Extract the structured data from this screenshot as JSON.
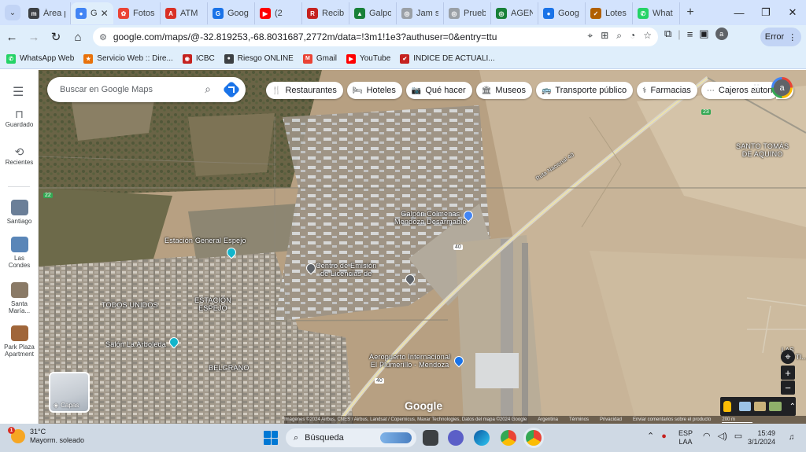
{
  "browser": {
    "tabs": [
      {
        "title": "Área p",
        "color": "#3c4043",
        "glyph": "m"
      },
      {
        "title": "G",
        "color": "#4285f4",
        "glyph": "●",
        "active": true
      },
      {
        "title": "Fotos",
        "color": "#ea4335",
        "glyph": "✿"
      },
      {
        "title": "ATM",
        "color": "#d93025",
        "glyph": "A"
      },
      {
        "title": "Goog",
        "color": "#1a73e8",
        "glyph": "G"
      },
      {
        "title": "(2",
        "color": "#ff0000",
        "glyph": "▶"
      },
      {
        "title": "Recib",
        "color": "#c5221f",
        "glyph": "R"
      },
      {
        "title": "Galpo",
        "color": "#188038",
        "glyph": "▲"
      },
      {
        "title": "Jam s",
        "color": "#9aa0a6",
        "glyph": "◎"
      },
      {
        "title": "Prueb",
        "color": "#9aa0a6",
        "glyph": "◎"
      },
      {
        "title": "AGEN",
        "color": "#188038",
        "glyph": "◎"
      },
      {
        "title": "Goog",
        "color": "#1a73e8",
        "glyph": "●"
      },
      {
        "title": "Lotes",
        "color": "#b06000",
        "glyph": "✓"
      },
      {
        "title": "What",
        "color": "#25d366",
        "glyph": "✆"
      }
    ],
    "url": "google.com/maps/@-32.819253,-68.8031687,2772m/data=!3m1!1e3?authuser=0&entry=ttu",
    "profile_initial": "a",
    "error_label": "Error"
  },
  "bookmarks": [
    {
      "label": "WhatsApp Web",
      "color": "#25d366",
      "glyph": "✆"
    },
    {
      "label": "Servicio Web :: Dire...",
      "color": "#e8710a",
      "glyph": "★"
    },
    {
      "label": "ICBC",
      "color": "#c5221f",
      "glyph": "◉"
    },
    {
      "label": "Riesgo ONLINE",
      "color": "#3c4043",
      "glyph": "●"
    },
    {
      "label": "Gmail",
      "color": "#ea4335",
      "glyph": "M"
    },
    {
      "label": "YouTube",
      "color": "#ff0000",
      "glyph": "▶"
    },
    {
      "label": "INDICE DE ACTUALI...",
      "color": "#c5221f",
      "glyph": "✔"
    }
  ],
  "rail": {
    "saved": "Guardado",
    "recents": "Recientes",
    "places": [
      {
        "label": "Santiago",
        "color": "#6b7f98"
      },
      {
        "label": "Las\nCondes",
        "color": "#5a86b8"
      },
      {
        "label": "Santa\nMaría...",
        "color": "#8a7a66"
      },
      {
        "label": "Park Plaza\nApartment",
        "color": "#a0663a"
      }
    ]
  },
  "maps": {
    "search_placeholder": "Buscar en Google Maps",
    "chips": [
      {
        "label": "Restaurantes",
        "icon": "🍴"
      },
      {
        "label": "Hoteles",
        "icon": "🛏"
      },
      {
        "label": "Qué hacer",
        "icon": "📷"
      },
      {
        "label": "Museos",
        "icon": "🏛"
      },
      {
        "label": "Transporte público",
        "icon": "🚌"
      },
      {
        "label": "Farmacias",
        "icon": "⚕"
      },
      {
        "label": "Cajeros auton",
        "icon": "⋯"
      }
    ],
    "account_initial": "a",
    "labels": {
      "santo_tomas": "SANTO TOMÁS\nDE AQUINO",
      "estacion_espejo": "Estación General Espejo",
      "todos_unidos": "TODOS UNIDOS",
      "estacion_espejo_area": "ESTACIÓN\nESPEJO",
      "salon": "Salón La Arboleda",
      "belgrano": "BELGRANO",
      "gasoline": "Galpón Colmenas\nMendoza Desarmable",
      "centro": "Centro de Emisión\nde Licencias de",
      "aeropuerto": "Aeropuerto Internacional\nEl Plumerillo - Mendoza",
      "ruta": "Ruta Nacional 40",
      "las_tiscas": "LAS\nLAS TI..."
    },
    "roads": {
      "r40a": "40",
      "r40b": "40",
      "r23": "23",
      "r2": "22"
    },
    "layers_label": "Capas",
    "google_logo": "Google",
    "attribution": "Imágenes ©2024 Airbus, CNES / Airbus, Landsat / Copernicus, Maxar Technologies, Datos del mapa ©2024 Google",
    "footer_links": [
      "Argentina",
      "Términos",
      "Privacidad",
      "Enviar comentarios sobre el producto"
    ],
    "scale": "200 m"
  },
  "taskbar": {
    "temp": "31°C",
    "weather": "Mayorm. soleado",
    "weather_badge": "1",
    "search": "Búsqueda",
    "lang1": "ESP",
    "lang2": "LAA",
    "time": "15:49",
    "date": "3/1/2024"
  }
}
